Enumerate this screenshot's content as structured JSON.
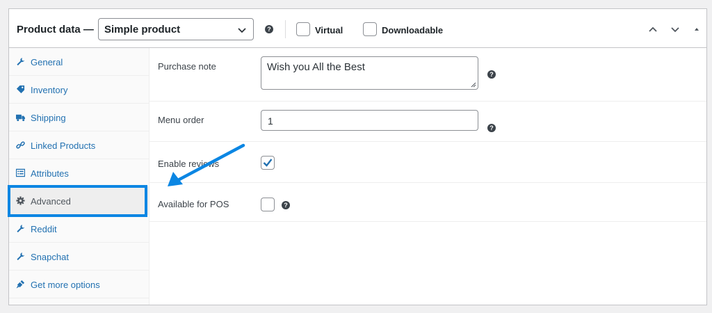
{
  "header": {
    "title": "Product data —",
    "product_type": "Simple product",
    "help_glyph": "?",
    "virtual_label": "Virtual",
    "downloadable_label": "Downloadable",
    "virtual_checked": false,
    "downloadable_checked": false
  },
  "sidebar": {
    "items": [
      {
        "label": "General",
        "icon": "wrench-icon"
      },
      {
        "label": "Inventory",
        "icon": "tag-icon"
      },
      {
        "label": "Shipping",
        "icon": "truck-icon"
      },
      {
        "label": "Linked Products",
        "icon": "link-icon"
      },
      {
        "label": "Attributes",
        "icon": "list-icon"
      },
      {
        "label": "Advanced",
        "icon": "gear-icon",
        "active": true
      },
      {
        "label": "Reddit",
        "icon": "wrench-icon"
      },
      {
        "label": "Snapchat",
        "icon": "wrench-icon"
      },
      {
        "label": "Get more options",
        "icon": "plugin-icon"
      }
    ]
  },
  "fields": {
    "purchase_note": {
      "label": "Purchase note",
      "value": "Wish you All the Best"
    },
    "menu_order": {
      "label": "Menu order",
      "value": "1"
    },
    "enable_reviews": {
      "label": "Enable reviews",
      "checked": true
    },
    "available_pos": {
      "label": "Available for POS",
      "checked": false
    }
  },
  "colors": {
    "link": "#2271b1",
    "highlight": "#0b86e3",
    "arrow": "#0b86e3",
    "check": "#2271b1"
  }
}
